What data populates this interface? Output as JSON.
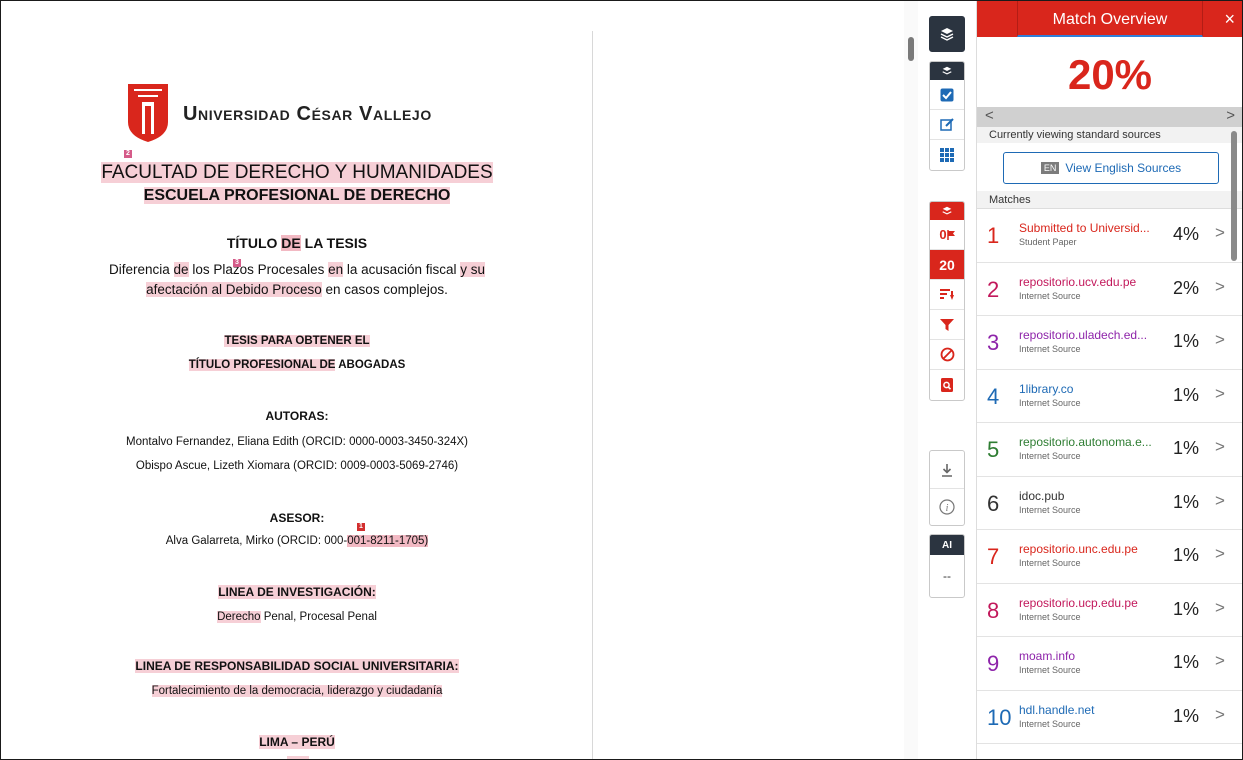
{
  "document": {
    "university": "Universidad César Vallejo",
    "faculty": "FACULTAD DE DERECHO Y HUMANIDADES",
    "school": "ESCUELA PROFESIONAL DE DERECHO",
    "title_heading_a": "TÍTULO ",
    "title_heading_b": "DE",
    "title_heading_c": " LA TESIS",
    "title_line1_a": "Diferencia ",
    "title_line1_b": "de",
    "title_line1_c": " los Plazos Procesales ",
    "title_line1_d": "en",
    "title_line1_e": " la acusación fiscal ",
    "title_line1_f": "y su",
    "title_line2_a": "afectación al",
    "title_line2_b": " Debido Proceso",
    "title_line2_c": " en casos complejos.",
    "thesis_for": "TESIS PARA OBTENER EL",
    "professional_title_a": "TÍTULO PROFESIONAL DE",
    "professional_title_b": " ABOGADAS",
    "authors_label": "AUTORAS:",
    "author1": "Montalvo Fernandez, Eliana Edith (ORCID: 0000-0003-3450-324X)",
    "author2": "Obispo Ascue, Lizeth Xiomara (ORCID: 0009-0003-5069-2746)",
    "advisor_label": "ASESOR:",
    "advisor_a": "Alva Galarreta, Mirko (ORCID: 000-",
    "advisor_b": "001-8211-1705)",
    "research_line_label": "LINEA DE INVESTIGACIÓN:",
    "research_line_a": "Derecho",
    "research_line_b": " Penal, Procesal Penal",
    "social_label": "LINEA DE RESPONSABILIDAD SOCIAL UNIVERSITARIA:",
    "social_value": "Fortalecimiento de la democracia, liderazgo y ciudadanía",
    "place": "LIMA – PERÚ",
    "markers": {
      "m1": "2",
      "m2": "3",
      "m3": "1"
    }
  },
  "toolbar": {
    "flag_count": "0",
    "match_count": "20",
    "ai_label": "AI",
    "ai_value": "--"
  },
  "panel": {
    "title": "Match Overview",
    "close": "×",
    "percent": "20%",
    "prev": "<",
    "next": ">",
    "viewing": "Currently viewing standard sources",
    "en_badge": "EN",
    "en_button": "View English Sources",
    "matches_label": "Matches",
    "chevron": ">",
    "matches": [
      {
        "n": "1",
        "source": "Submitted to Universid...",
        "type": "Student Paper",
        "pct": "4%",
        "color": "#d9261c"
      },
      {
        "n": "2",
        "source": "repositorio.ucv.edu.pe",
        "type": "Internet Source",
        "pct": "2%",
        "color": "#c2185b"
      },
      {
        "n": "3",
        "source": "repositorio.uladech.ed...",
        "type": "Internet Source",
        "pct": "1%",
        "color": "#8e24aa"
      },
      {
        "n": "4",
        "source": "1library.co",
        "type": "Internet Source",
        "pct": "1%",
        "color": "#1e6ab5"
      },
      {
        "n": "5",
        "source": "repositorio.autonoma.e...",
        "type": "Internet Source",
        "pct": "1%",
        "color": "#2e7d32"
      },
      {
        "n": "6",
        "source": "idoc.pub",
        "type": "Internet Source",
        "pct": "1%",
        "color": "#333333"
      },
      {
        "n": "7",
        "source": "repositorio.unc.edu.pe",
        "type": "Internet Source",
        "pct": "1%",
        "color": "#d9261c"
      },
      {
        "n": "8",
        "source": "repositorio.ucp.edu.pe",
        "type": "Internet Source",
        "pct": "1%",
        "color": "#c2185b"
      },
      {
        "n": "9",
        "source": "moam.info",
        "type": "Internet Source",
        "pct": "1%",
        "color": "#8e24aa"
      },
      {
        "n": "10",
        "source": "hdl.handle.net",
        "type": "Internet Source",
        "pct": "1%",
        "color": "#1e6ab5"
      }
    ]
  }
}
